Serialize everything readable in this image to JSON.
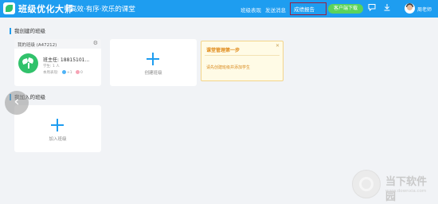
{
  "header": {
    "brand_name": "班级优化大师",
    "slogan": "高效·有序·欢乐的课堂",
    "nav": [
      "班级表现",
      "发送消息",
      "成绩报告"
    ],
    "download_label": "客户端下载",
    "user_name": "周老师"
  },
  "my_classes": {
    "title": "我创建的班级",
    "class_card": {
      "name_id": "我的班级 (A47212)",
      "teacher": "班主任: 18815101...",
      "students": "学生: 1 人",
      "performance_label": "本周表现:",
      "plus": "+1",
      "minus": "0"
    },
    "create_label": "创建班级"
  },
  "tip": {
    "title": "课堂管理第一步",
    "text": "请先创建班级并添加学生"
  },
  "joined_classes": {
    "title": "我加入的班级",
    "join_label": "加入班级"
  },
  "watermark": {
    "title": "当下软件园",
    "subtitle": "www.downxia.com"
  }
}
